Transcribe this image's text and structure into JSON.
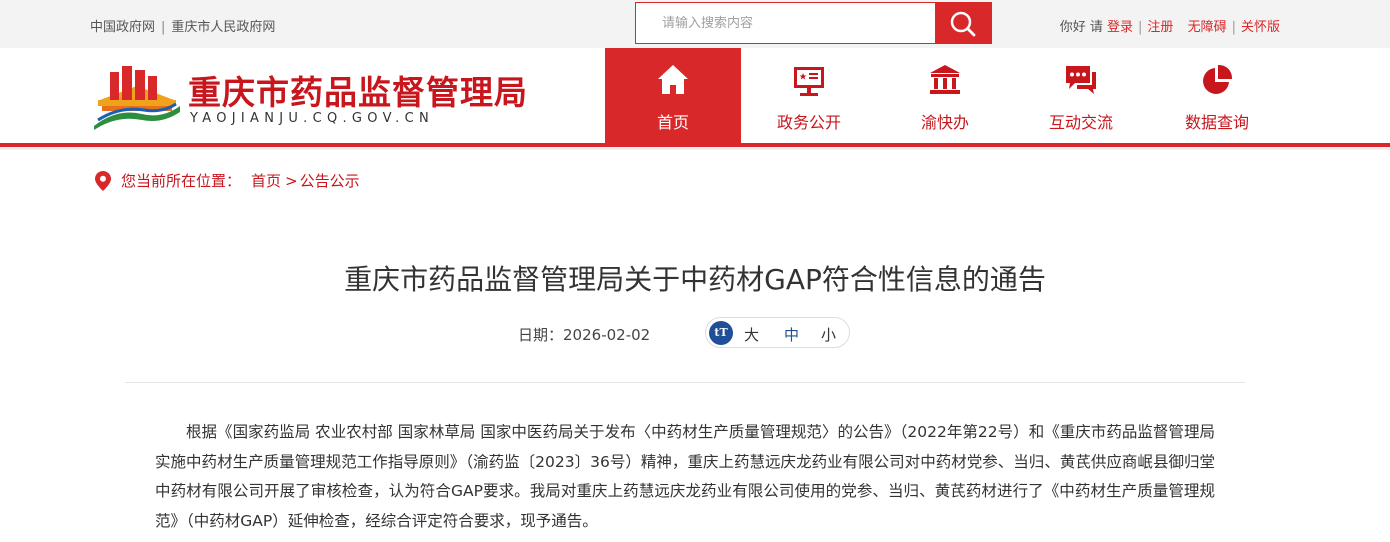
{
  "topbar": {
    "links": [
      "中国政府网",
      "重庆市人民政府网"
    ],
    "search": {
      "placeholder": "请输入搜索内容",
      "icon": "search-icon"
    },
    "greeting": "你好",
    "please": "请",
    "login": "登录",
    "register": "注册",
    "accessible": "无障碍",
    "elderly": "关怀版"
  },
  "header": {
    "logo_title": "重庆市药品监督管理局",
    "logo_subtitle": "YAOJIANJU.CQ.GOV.CN",
    "nav": [
      {
        "label": "首页",
        "icon": "home-icon",
        "active": true
      },
      {
        "label": "政务公开",
        "icon": "monitor-icon",
        "active": false
      },
      {
        "label": "渝快办",
        "icon": "government-building-icon",
        "active": false
      },
      {
        "label": "互动交流",
        "icon": "chat-icon",
        "active": false
      },
      {
        "label": "数据查询",
        "icon": "pie-chart-icon",
        "active": false
      }
    ]
  },
  "breadcrumb": {
    "label": "您当前所在位置：",
    "home": "首页",
    "separator": ">",
    "current": "公告公示"
  },
  "article": {
    "title": "重庆市药品监督管理局关于中药材GAP符合性信息的通告",
    "date_label": "日期：",
    "date": "2026-02-02",
    "font_icon": "tT",
    "font_sizes": [
      "大",
      "中",
      "小"
    ],
    "body": "根据《国家药监局 农业农村部 国家林草局 国家中医药局关于发布〈中药材生产质量管理规范〉的公告》（2022年第22号）和《重庆市药品监督管理局实施中药材生产质量管理规范工作指导原则》（渝药监〔2023〕36号）精神，重庆上药慧远庆龙药业有限公司对中药材党参、当归、黄芪供应商岷县御归堂中药材有限公司开展了审核检查，认为符合GAP要求。我局对重庆上药慧远庆龙药业有限公司使用的党参、当归、黄芪药材进行了《中药材生产质量管理规范》（中药材GAP）延伸检查，经综合评定符合要求，现予通告。"
  },
  "colors": {
    "brand_red": "#d9282a",
    "title_red": "#c8161d",
    "font_badge_blue": "#1f4f96"
  }
}
